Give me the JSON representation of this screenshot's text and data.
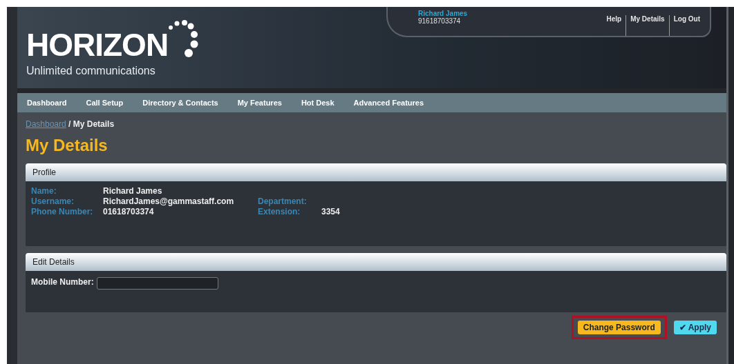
{
  "logo": {
    "name": "HORIZON",
    "tagline": "Unlimited communications"
  },
  "user_panel": {
    "name": "Richard James",
    "number": "91618703374",
    "links": [
      "Help",
      "My Details",
      "Log Out"
    ]
  },
  "nav": [
    "Dashboard",
    "Call Setup",
    "Directory & Contacts",
    "My Features",
    "Hot Desk",
    "Advanced Features"
  ],
  "breadcrumb": {
    "link": "Dashboard",
    "current": "/ My Details"
  },
  "page_title": "My Details",
  "profile": {
    "title": "Profile",
    "fields": [
      {
        "label": "Name:",
        "value": "Richard James"
      },
      {
        "label": "Username:",
        "value": "RichardJames@gammastaff.com",
        "label2": "Department:"
      },
      {
        "label": "Phone Number:",
        "value": "01618703374",
        "label2": "Extension:",
        "value2": "3354"
      }
    ]
  },
  "edit_details": {
    "title": "Edit Details",
    "fields": [
      {
        "label": "Mobile Number:"
      }
    ]
  },
  "buttons": [
    {
      "label": "Change Password",
      "kind": "highlighted"
    },
    {
      "label": "✔ Apply",
      "kind": "apply"
    }
  ]
}
